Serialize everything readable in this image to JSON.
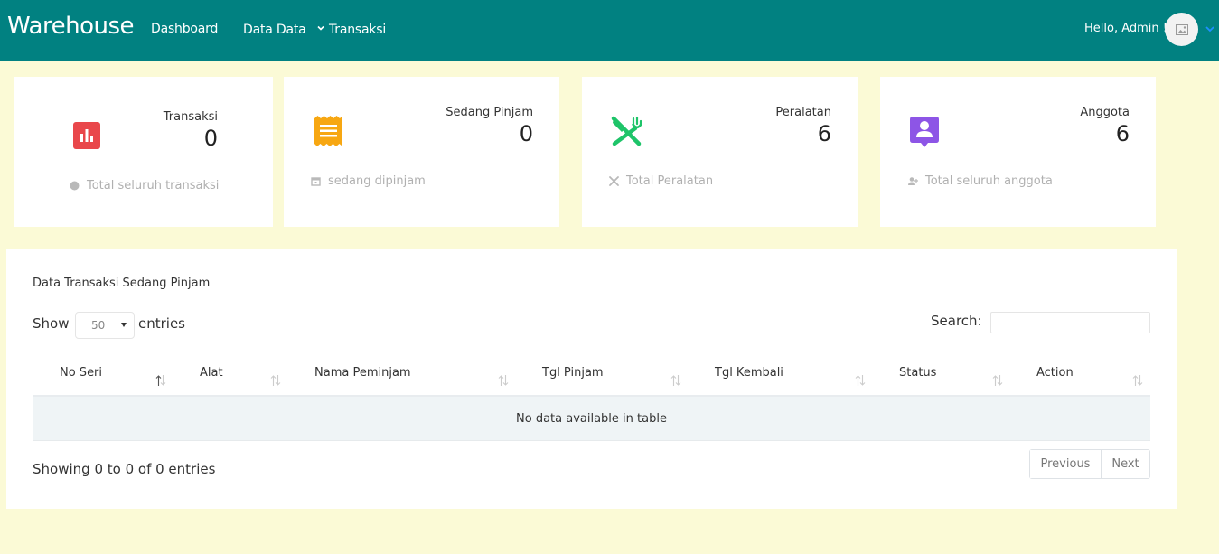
{
  "navbar": {
    "brand": "Warehouse",
    "dashboard": "Dashboard",
    "data_data": "Data Data",
    "transaksi": "Transaksi",
    "greeting": "Hello, Admin !"
  },
  "cards": [
    {
      "title": "Transaksi",
      "value": "0",
      "footer": "Total seluruh transaksi",
      "icon": "bar-chart-icon",
      "color": "#e9474b"
    },
    {
      "title": "Sedang Pinjam",
      "value": "0",
      "footer": "sedang dipinjam",
      "icon": "receipt-icon",
      "color": "#f7a712"
    },
    {
      "title": "Peralatan",
      "value": "6",
      "footer": "Total Peralatan",
      "icon": "fork-knife-icon",
      "color": "#1ec469"
    },
    {
      "title": "Anggota",
      "value": "6",
      "footer": "Total seluruh anggota",
      "icon": "contact-icon",
      "color": "#8d55e6"
    }
  ],
  "table": {
    "title": "Data Transaksi Sedang Pinjam",
    "show_label": "Show",
    "length_value": "50",
    "entries_label": "entries",
    "search_label": "Search:",
    "search_value": "",
    "columns": [
      "No Seri",
      "Alat",
      "Nama Peminjam",
      "Tgl Pinjam",
      "Tgl Kembali",
      "Status",
      "Action"
    ],
    "empty_message": "No data available in table",
    "info": "Showing 0 to 0 of 0 entries",
    "prev_label": "Previous",
    "next_label": "Next"
  },
  "colors": {
    "navbar": "#018181",
    "background": "#fbfad6"
  }
}
